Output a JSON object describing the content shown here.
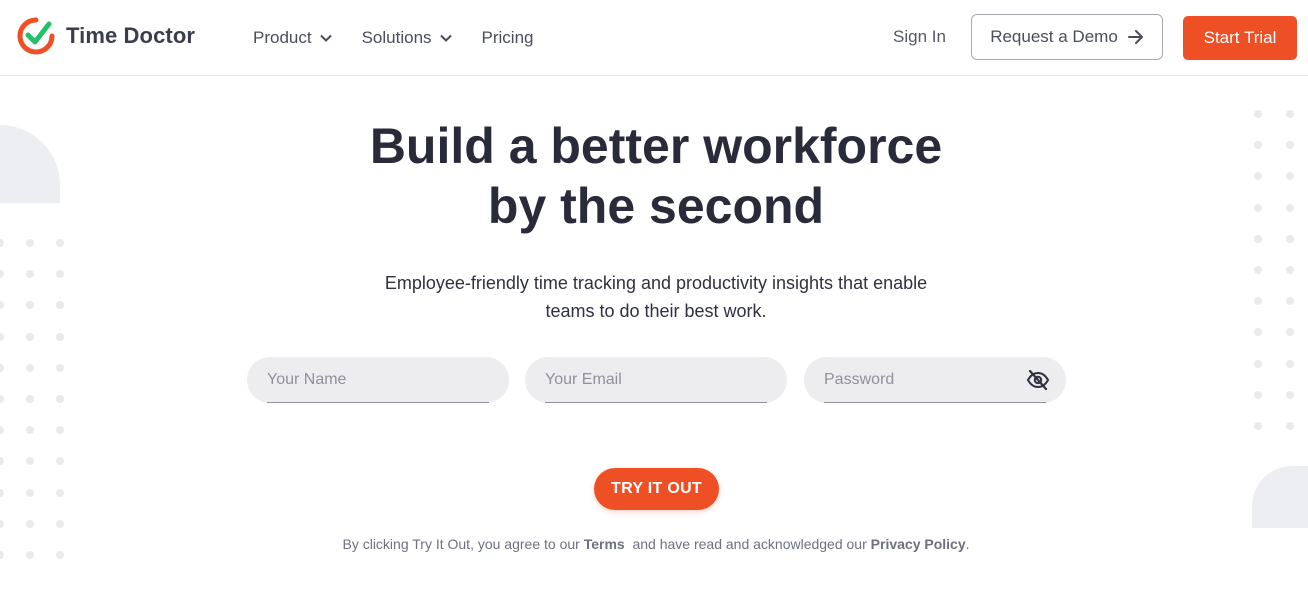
{
  "brand": {
    "name": "Time Doctor",
    "accent": "#ef4f24",
    "check_color": "#27c06a"
  },
  "nav": {
    "items": [
      {
        "label": "Product",
        "has_dropdown": true
      },
      {
        "label": "Solutions",
        "has_dropdown": true
      },
      {
        "label": "Pricing",
        "has_dropdown": false
      }
    ],
    "sign_in": "Sign In",
    "request_demo": "Request a Demo",
    "start_trial": "Start Trial"
  },
  "hero": {
    "headline_line1": "Build a better workforce",
    "headline_line2": "by the second",
    "subline_line1": "Employee-friendly time tracking and productivity insights that enable",
    "subline_line2": "teams to do their best work."
  },
  "form": {
    "name_placeholder": "Your Name",
    "email_placeholder": "Your Email",
    "password_placeholder": "Password",
    "password_toggle_icon": "eye-slash-icon",
    "submit_label": "TRY IT OUT"
  },
  "legal": {
    "prefix": "By clicking Try It Out, you agree to our",
    "terms_link": "Terms",
    "middle": "and have read and acknowledged our",
    "privacy_link": "Privacy Policy",
    "suffix": "."
  }
}
